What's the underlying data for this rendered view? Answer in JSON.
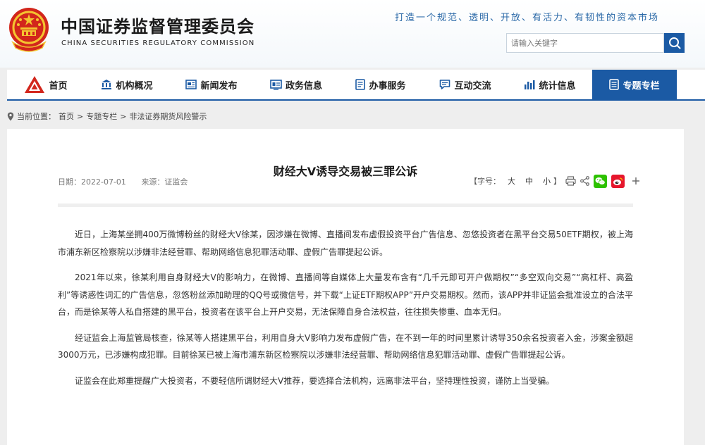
{
  "header": {
    "title_cn": "中国证券监督管理委员会",
    "title_en": "CHINA SECURITIES REGULATORY COMMISSION",
    "slogan": "打造一个规范、透明、开放、有活力、有韧性的资本市场",
    "search_placeholder": "请输入关键字",
    "emblem_icon": "national-emblem-icon",
    "search_icon": "search-icon"
  },
  "nav": {
    "items": [
      {
        "label": "首页",
        "icon": "home-logo-icon"
      },
      {
        "label": "机构概况",
        "icon": "institution-icon"
      },
      {
        "label": "新闻发布",
        "icon": "news-icon"
      },
      {
        "label": "政务信息",
        "icon": "government-info-icon"
      },
      {
        "label": "办事服务",
        "icon": "service-icon"
      },
      {
        "label": "互动交流",
        "icon": "chat-icon"
      },
      {
        "label": "统计信息",
        "icon": "statistics-icon"
      },
      {
        "label": "专题专栏",
        "icon": "topic-icon"
      }
    ],
    "active_index": 7,
    "accent_color": "#1b5aa4"
  },
  "breadcrumb": {
    "prefix": "当前位置：",
    "items": [
      "首页",
      "专题专栏",
      "非法证券期货风险警示"
    ],
    "separator": ">"
  },
  "article": {
    "title": "财经大V诱导交易被三罪公诉",
    "date": "日期：2022-07-01",
    "source": "来源：证监会",
    "font_size_label": "【字号：",
    "font_sizes": [
      "大",
      "中",
      "小"
    ],
    "font_size_close": "】",
    "paragraphs": [
      "近日，上海某坐拥400万微博粉丝的财经大V徐某，因涉嫌在微博、直播间发布虚假投资平台广告信息、忽悠投资者在黑平台交易50ETF期权，被上海市浦东新区检察院以涉嫌非法经营罪、帮助网络信息犯罪活动罪、虚假广告罪提起公诉。",
      "2021年以来，徐某利用自身财经大V的影响力，在微博、直播间等自媒体上大量发布含有“几千元即可开户做期权”“多空双向交易”“高杠杆、高盈利”等诱惑性词汇的广告信息，忽悠粉丝添加助理的QQ号或微信号，并下载“上证ETF期权APP”开户交易期权。然而，该APP并非证监会批准设立的合法平台，而是徐某等人私自搭建的黑平台，投资者在该平台上开户交易，无法保障自身合法权益，往往损失惨重、血本无归。",
      "经证监会上海监管局核查，徐某等人搭建黑平台，利用自身大V影响力发布虚假广告，在不到一年的时间里累计诱导350余名投资者入金，涉案金额超3000万元，已涉嫌构成犯罪。目前徐某已被上海市浦东新区检察院以涉嫌非法经营罪、帮助网络信息犯罪活动罪、虚假广告罪提起公诉。",
      "证监会在此郑重提醒广大投资者，不要轻信所谓财经大V推荐，要选择合法机构，远离非法平台，坚持理性投资，谨防上当受骗。"
    ],
    "tool_icons": [
      "print-icon",
      "share-icon",
      "wechat-icon",
      "weibo-icon",
      "plus-icon"
    ],
    "wechat_color": "#2dc100",
    "weibo_color": "#e6162d"
  }
}
